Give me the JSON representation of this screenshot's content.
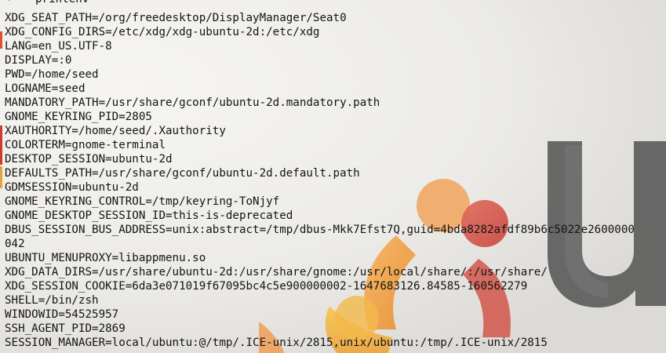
{
  "prompt": {
    "arrow": "➜",
    "cwd": "~",
    "command": "printenv"
  },
  "output_lines": [
    "XDG_SEAT_PATH=/org/freedesktop/DisplayManager/Seat0",
    "XDG_CONFIG_DIRS=/etc/xdg/xdg-ubuntu-2d:/etc/xdg",
    "LANG=en_US.UTF-8",
    "DISPLAY=:0",
    "PWD=/home/seed",
    "LOGNAME=seed",
    "MANDATORY_PATH=/usr/share/gconf/ubuntu-2d.mandatory.path",
    "GNOME_KEYRING_PID=2805",
    "XAUTHORITY=/home/seed/.Xauthority",
    "COLORTERM=gnome-terminal",
    "DESKTOP_SESSION=ubuntu-2d",
    "DEFAULTS_PATH=/usr/share/gconf/ubuntu-2d.default.path",
    "GDMSESSION=ubuntu-2d",
    "GNOME_KEYRING_CONTROL=/tmp/keyring-ToNjyf",
    "GNOME_DESKTOP_SESSION_ID=this-is-deprecated",
    "DBUS_SESSION_BUS_ADDRESS=unix:abstract=/tmp/dbus-Mkk7Efst7Q,guid=4bda8282afdf89b6c5022e2600000",
    "042",
    "UBUNTU_MENUPROXY=libappmenu.so",
    "XDG_DATA_DIRS=/usr/share/ubuntu-2d:/usr/share/gnome:/usr/local/share/:/usr/share/",
    "XDG_SESSION_COOKIE=6da3e071019f67095bc4c5e900000002-1647683126.84585-160562279",
    "SHELL=/bin/zsh",
    "WINDOWID=54525957",
    "SSH_AGENT_PID=2869",
    "SESSION_MANAGER=local/ubuntu:@/tmp/.ICE-unix/2815,unix/ubuntu:/tmp/.ICE-unix/2815"
  ],
  "colors": {
    "text": "#141414",
    "prompt_arrow": "#3aa83a",
    "prompt_cwd": "#2aa9b0",
    "background": "#ececea"
  },
  "wallpaper": {
    "logo_icon": "ubuntu-circle-of-friends-logo"
  }
}
